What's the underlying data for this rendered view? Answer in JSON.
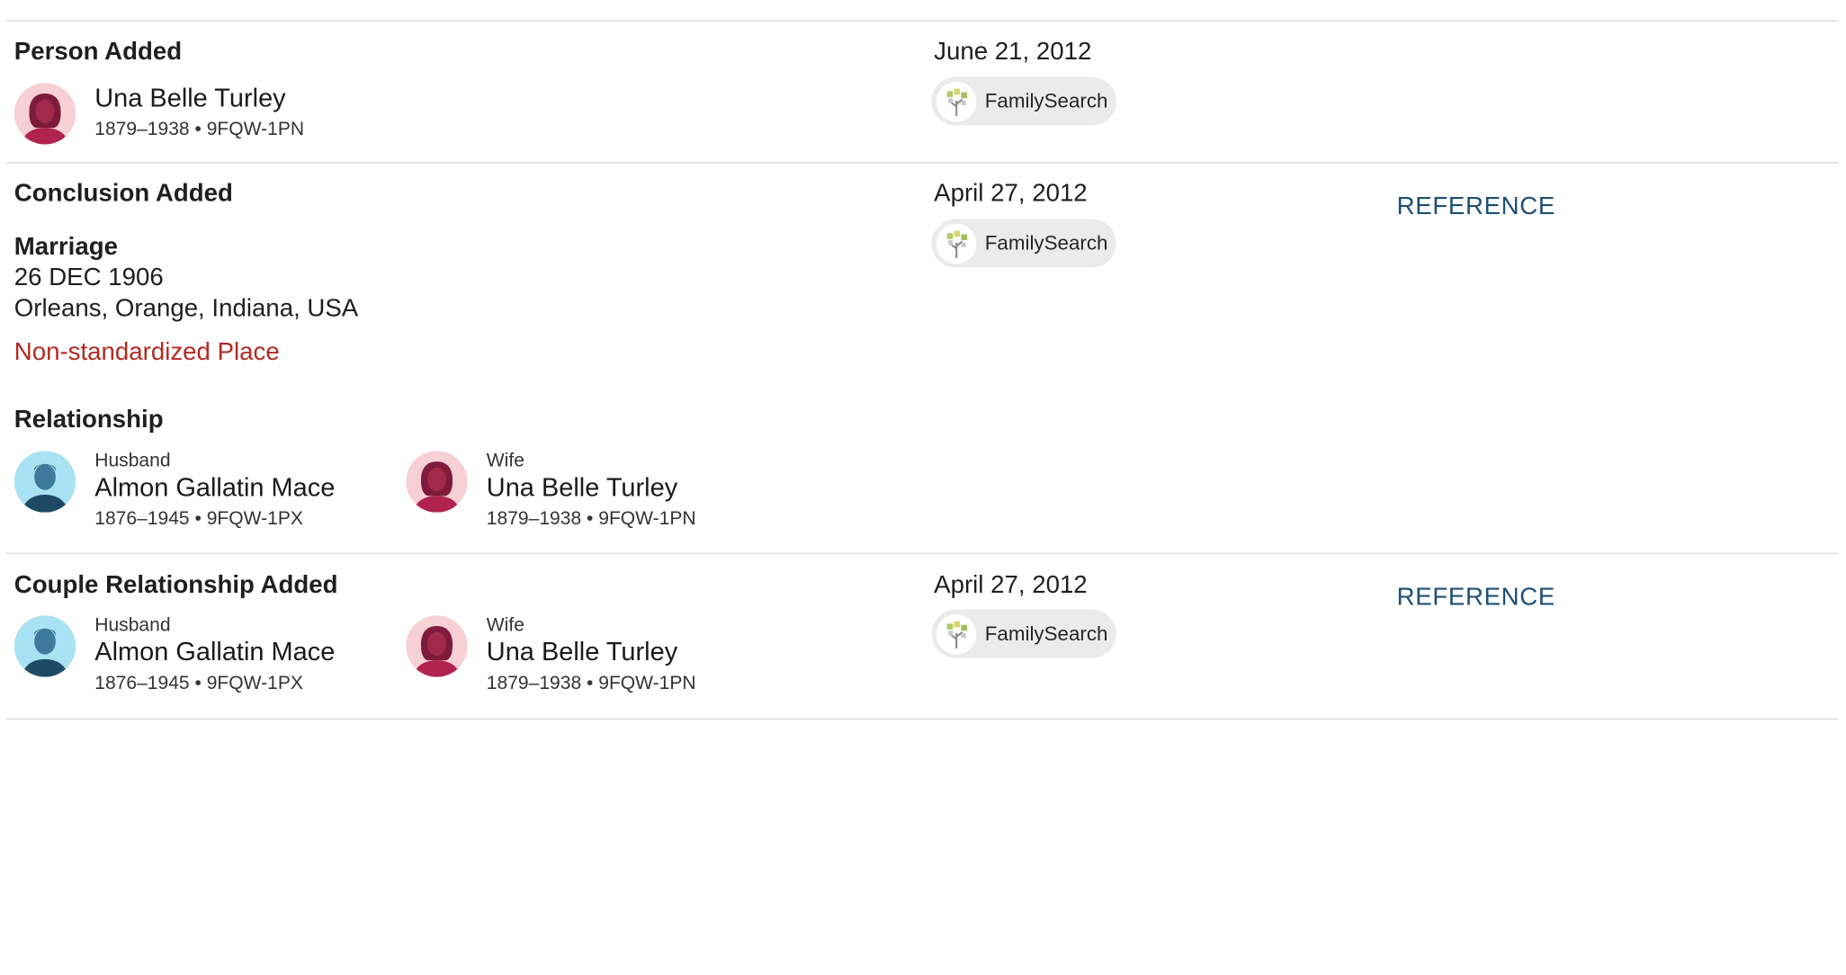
{
  "colors": {
    "reference_link": "#1d4f74",
    "warning": "#b22a22",
    "female_avatar_bg": "#f6d0d4",
    "male_avatar_bg": "#a9e2f2"
  },
  "entries": [
    {
      "title": "Person Added",
      "date": "June 21, 2012",
      "contributor": "FamilySearch",
      "person": {
        "name": "Una Belle Turley",
        "meta": "1879–1938 • 9FQW-1PN",
        "gender_icon": "female-avatar-icon"
      }
    },
    {
      "title": "Conclusion Added",
      "date": "April 27, 2012",
      "contributor": "FamilySearch",
      "reference": "REFERENCE",
      "fact": {
        "label": "Marriage",
        "date": "26 DEC 1906",
        "place": "Orleans, Orange, Indiana, USA",
        "warning": "Non-standardized Place"
      },
      "relationship_label": "Relationship",
      "husband": {
        "role": "Husband",
        "name": "Almon Gallatin Mace",
        "meta": "1876–1945 • 9FQW-1PX",
        "gender_icon": "male-avatar-icon"
      },
      "wife": {
        "role": "Wife",
        "name": "Una Belle Turley",
        "meta": "1879–1938 • 9FQW-1PN",
        "gender_icon": "female-avatar-icon"
      }
    },
    {
      "title": "Couple Relationship Added",
      "date": "April 27, 2012",
      "contributor": "FamilySearch",
      "reference": "REFERENCE",
      "husband": {
        "role": "Husband",
        "name": "Almon Gallatin Mace",
        "meta": "1876–1945 • 9FQW-1PX",
        "gender_icon": "male-avatar-icon"
      },
      "wife": {
        "role": "Wife",
        "name": "Una Belle Turley",
        "meta": "1879–1938 • 9FQW-1PN",
        "gender_icon": "female-avatar-icon"
      }
    }
  ]
}
